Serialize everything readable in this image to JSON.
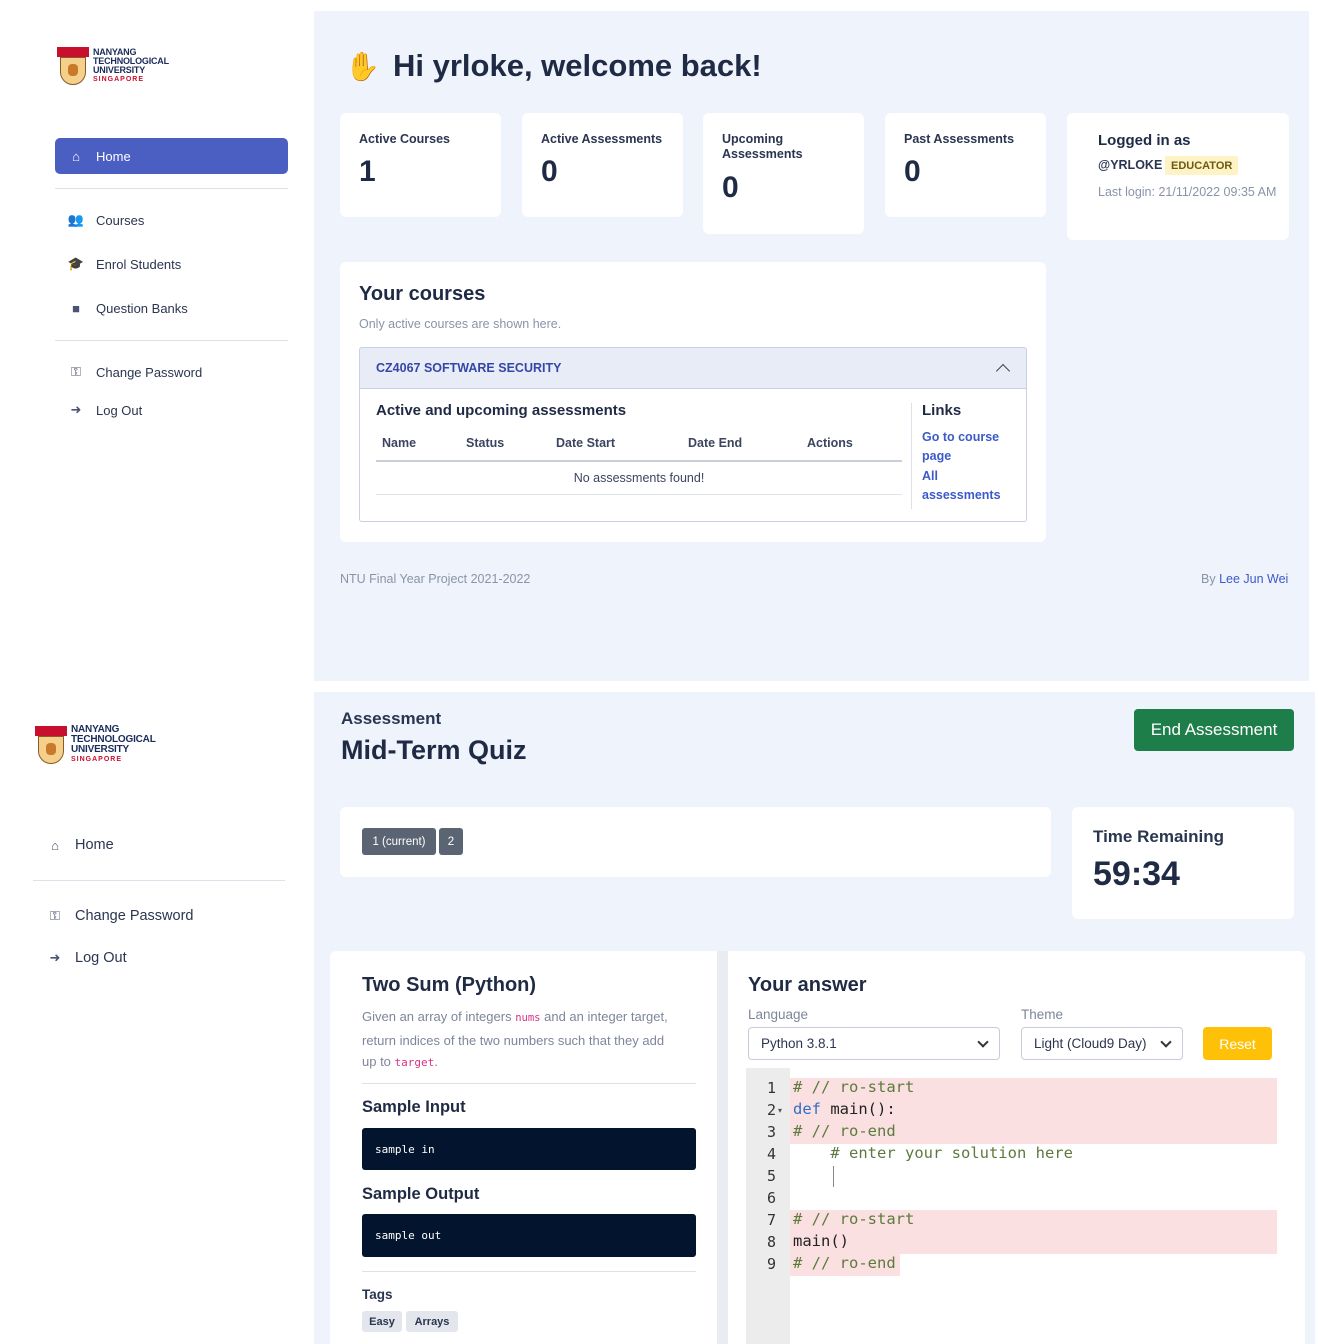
{
  "screen1": {
    "logo": {
      "line1": "NANYANG",
      "line2": "TECHNOLOGICAL",
      "line3": "UNIVERSITY",
      "line4": "SINGAPORE"
    },
    "sidebar": {
      "home": "Home",
      "courses": "Courses",
      "enrol": "Enrol Students",
      "qbanks": "Question Banks",
      "change_password": "Change Password",
      "logout": "Log Out"
    },
    "greeting": "Hi yrloke, welcome back!",
    "stats": [
      {
        "label": "Active Courses",
        "value": "1"
      },
      {
        "label": "Active Assessments",
        "value": "0"
      },
      {
        "label": "Upcoming Assessments",
        "value": "0"
      },
      {
        "label": "Past Assessments",
        "value": "0"
      }
    ],
    "login": {
      "title": "Logged in as",
      "user": "@YRLOKE",
      "role": "EDUCATOR",
      "last_login": "Last login: 21/11/2022 09:35 AM"
    },
    "courses": {
      "title": "Your courses",
      "subtitle": "Only active courses are shown here.",
      "course_name": "CZ4067 SOFTWARE SECURITY",
      "assess_title": "Active and upcoming assessments",
      "columns": [
        "Name",
        "Status",
        "Date Start",
        "Date End",
        "Actions"
      ],
      "empty": "No assessments found!",
      "links_title": "Links",
      "link1": "Go to course page",
      "link2": "All assessments"
    },
    "footer": {
      "left": "NTU Final Year Project 2021-2022",
      "right_prefix": "By",
      "right_name": "Lee Jun Wei"
    }
  },
  "screen2": {
    "logo": {
      "line1": "NANYANG",
      "line2": "TECHNOLOGICAL",
      "line3": "UNIVERSITY",
      "line4": "SINGAPORE"
    },
    "sidebar": {
      "home": "Home",
      "change_password": "Change Password",
      "logout": "Log Out"
    },
    "assessment_label": "Assessment",
    "assessment_title": "Mid-Term Quiz",
    "end_button": "End Assessment",
    "questions": [
      "1 (current)",
      "2"
    ],
    "timer": {
      "label": "Time Remaining",
      "value": "59:34"
    },
    "question": {
      "title": "Two Sum (Python)",
      "desc_1": "Given an array of integers",
      "desc_code1": "nums",
      "desc_2": "and an integer target,",
      "desc_3": "return indices of the two numbers such that they add",
      "desc_4": "up to",
      "desc_code2": "target",
      "desc_5": ".",
      "sample_input_title": "Sample Input",
      "sample_input": "sample in",
      "sample_output_title": "Sample Output",
      "sample_output": "sample out",
      "tags_title": "Tags",
      "tags": [
        "Easy",
        "Arrays"
      ]
    },
    "answer": {
      "title": "Your answer",
      "language_label": "Language",
      "language": "Python 3.8.1",
      "theme_label": "Theme",
      "theme": "Light (Cloud9 Day)",
      "reset": "Reset",
      "line_numbers": [
        "1",
        "2",
        "3",
        "4",
        "5",
        "6",
        "7",
        "8",
        "9"
      ],
      "code": {
        "l1": "# // ro-start",
        "l2_kw": "def",
        "l2_rest": " main():",
        "l3": "# // ro-end",
        "l4": "    # enter your solution here",
        "l7": "# // ro-start",
        "l8": "main()",
        "l9": "# // ro-end"
      }
    }
  },
  "colors": {
    "primary": "#4a5fc1",
    "success": "#1e7e4a",
    "warning": "#ffc107",
    "panel": "#eef3fc",
    "readonly": "#fae0e0"
  }
}
